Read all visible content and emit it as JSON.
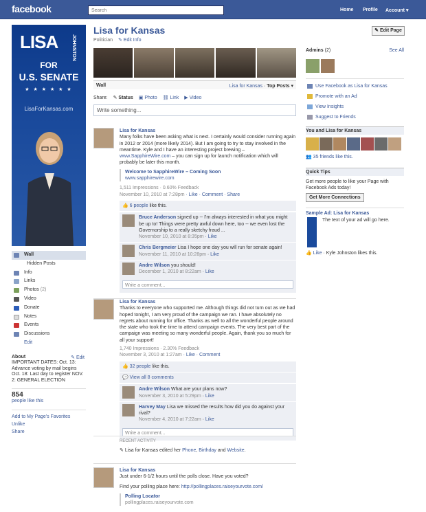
{
  "topbar": {
    "logo": "facebook",
    "search_placeholder": "Search",
    "home": "Home",
    "profile": "Profile",
    "account": "Account"
  },
  "profile": {
    "pic_first": "LISA",
    "pic_last": "JOHNSTON",
    "pic_for": "FOR",
    "pic_office": "U.S. SENATE",
    "pic_url": "LisaForKansas.com",
    "nav": [
      {
        "label": "Wall",
        "icon": "wall-icon"
      },
      {
        "label": "Hidden Posts",
        "icon": ""
      },
      {
        "label": "Info",
        "icon": "info-icon"
      },
      {
        "label": "Links",
        "icon": "links-icon"
      },
      {
        "label": "Photos",
        "count": "(2)",
        "icon": "photos-icon"
      },
      {
        "label": "Video",
        "icon": "video-icon"
      },
      {
        "label": "Donate",
        "icon": "donate-icon"
      },
      {
        "label": "Notes",
        "icon": "notes-icon"
      },
      {
        "label": "Events",
        "icon": "events-icon"
      },
      {
        "label": "Discussions",
        "icon": "discussions-icon"
      }
    ],
    "edit": "Edit",
    "about_label": "About",
    "about_edit": "Edit",
    "about_text": "IMPORTANT DATES: Oct. 13: Advance voting by mail begins Oct. 18: Last day to register NOV. 2: GENERAL ELECTION",
    "likes_count": "854",
    "likes_label": "people like this",
    "add_favorites": "Add to My Page's Favorites",
    "unlike": "Unlike",
    "share": "Share"
  },
  "header": {
    "title": "Lisa for Kansas",
    "category": "Politician",
    "edit_info": "Edit Info",
    "edit_page": "Edit Page"
  },
  "wall": {
    "label": "Wall",
    "filter_name": "Lisa for Kansas",
    "filter_sep": "·",
    "filter_top": "Top Posts"
  },
  "share": {
    "label": "Share:",
    "status": "Status",
    "photo": "Photo",
    "link": "Link",
    "video": "Video",
    "placeholder": "Write something..."
  },
  "posts": [
    {
      "author": "Lisa for Kansas",
      "text": "Many folks have been asking what is next. I certainly would consider running again in 2012 or 2014 (more likely 2014). But I am going to try to stay involved in the meantime. Kyle and I have an interesting project brewing –",
      "link_inline": "www.SapphireWire.com",
      "text_after": "– you can sign up for launch notification which will probably be later this month.",
      "link_title": "Welcome to SapphireWire – Coming Soon",
      "link_url": "www.sapphirewire.com",
      "impressions": "1,511 Impressions · 0.60% Feedback",
      "time": "November 10, 2010 at 7:28pm",
      "actions": "· Like · Comment · Share",
      "likes": "6 people",
      "likes_suffix": "like this.",
      "comments": [
        {
          "name": "Bruce Anderson",
          "text": "signed up -- I'm always interested in what you might be up to! Things were pretty awful down here, too -- we even lost the Governorship to a really sketchy fraud ...",
          "time": "November 10, 2010 at 8:35pm",
          "like": "Like"
        },
        {
          "name": "Chris Bergmeier",
          "text": "Lisa I hope one day you will run for senate again!",
          "time": "November 11, 2010 at 10:28pm",
          "like": "Like"
        },
        {
          "name": "Andre Wilson",
          "text": "you should!",
          "time": "December 1, 2010 at 8:22am",
          "like": "Like"
        }
      ],
      "write_comment": "Write a comment..."
    },
    {
      "author": "Lisa for Kansas",
      "text": "Thanks to everyone who supported me. Although things did not turn out as we had hoped tonight, I am very proud of the campaign we ran. I have absolutely no regrets about running for office. Thanks as well to all the wonderful people around the state who took the time to attend campaign events. The very best part of the campaign was meeting so many wonderful people. Again, thank you so much for all your support!",
      "impressions": "1,740 Impressions · 2.30% Feedback",
      "time": "November 3, 2010 at 1:27am",
      "actions": "· Like · Comment",
      "likes": "32 people",
      "likes_suffix": "like this.",
      "view_all": "View all 8 comments",
      "comments": [
        {
          "name": "Andre Wilson",
          "text": "What are your plans now?",
          "time": "November 3, 2010 at 5:29pm",
          "like": "Like"
        },
        {
          "name": "Harvey May",
          "text": "Lisa we missed the results how did you do against your rival?",
          "time": "November 4, 2010 at 7:22am",
          "like": "Like"
        }
      ],
      "write_comment": "Write a comment..."
    }
  ],
  "recent": {
    "label": "RECENT ACTIVITY",
    "text_pre": "Lisa for Kansas edited her",
    "l1": "Phone",
    "l2": "Birthday",
    "and": "and",
    "l3": "Website"
  },
  "post3": {
    "author": "Lisa for Kansas",
    "text": "Just under 6-1/2 hours until the polls close. Have you voted?",
    "find": "Find your polling place here:",
    "find_url": "http://pollingplaces.raiseyourvote.com/",
    "link_title": "Polling Locator",
    "link_url": "pollingplaces.raiseyourvote.com"
  },
  "right": {
    "admins_label": "Admins",
    "admins_count": "(2)",
    "see_all": "See All",
    "actions": [
      "Use Facebook as Lisa for Kansas",
      "Promote with an Ad",
      "View Insights",
      "Suggest to Friends"
    ],
    "you_and": "You and Lisa for Kansas",
    "friends_like": "35 friends like this.",
    "quick_tips": "Quick Tips",
    "tips_text": "Get more people to like your Page with Facebook Ads today!",
    "more_connections": "Get More Connections",
    "sample_ad": "Sample Ad: Lisa for Kansas",
    "ad_text": "The text of your ad will go here.",
    "ad_like": "Like",
    "ad_likes": "· Kyle Johnston likes this."
  },
  "colors": {
    "brand": "#3b5998",
    "link": "#3b5998",
    "nav_sel": "#d8dfea"
  }
}
